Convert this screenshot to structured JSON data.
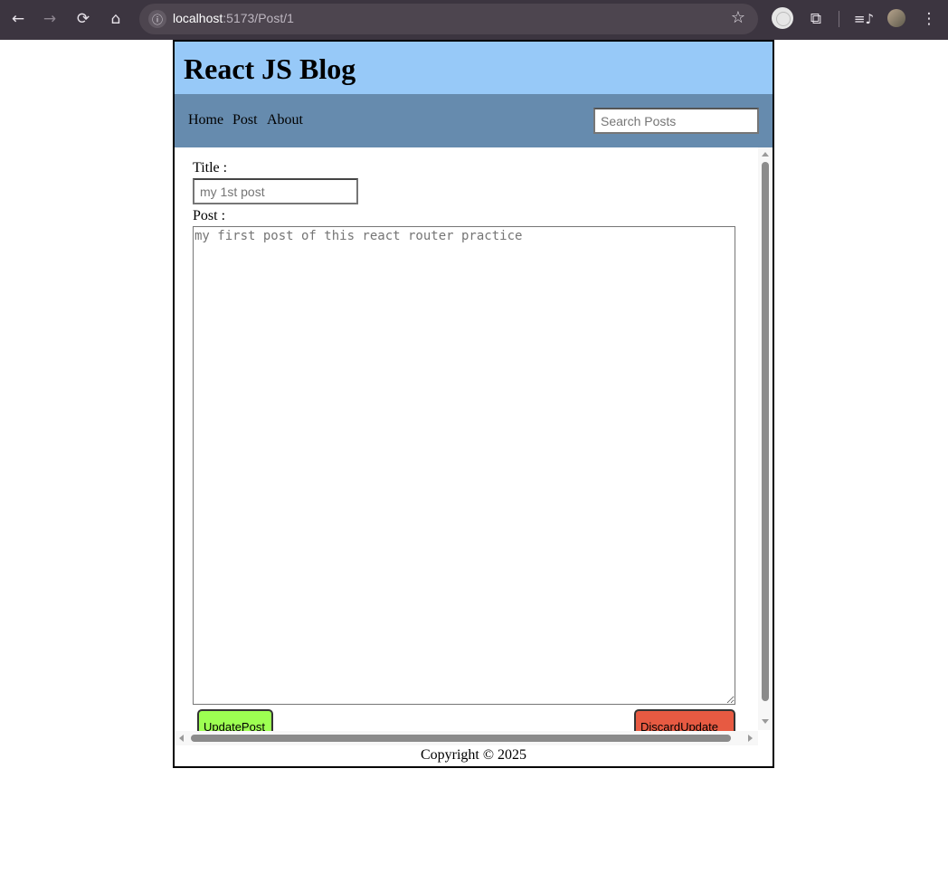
{
  "browser": {
    "url_host": "localhost",
    "url_rest": ":5173/Post/1",
    "back_icon": "←",
    "forward_icon": "→",
    "reload_icon": "⟳",
    "home_icon": "⌂",
    "info_icon": "ⓘ",
    "star_icon": "☆",
    "extensions_icon": "⧉",
    "media_icon": "≡♪",
    "menu_icon": "⋮"
  },
  "header": {
    "title": "React JS Blog"
  },
  "nav": {
    "items": [
      {
        "label": "Home"
      },
      {
        "label": "Post"
      },
      {
        "label": "About"
      }
    ],
    "search_placeholder": "Search Posts"
  },
  "form": {
    "title_label": "Title :",
    "title_placeholder": "my 1st post",
    "post_label": "Post :",
    "post_placeholder": "my first post of this react router practice",
    "update_button": "UpdatePost",
    "discard_button": "DiscardUpdate"
  },
  "colors": {
    "header_bg": "#97c9f8",
    "nav_bg": "#668bae",
    "update_bg": "#9dff52",
    "discard_bg": "#e75a42"
  },
  "footer": {
    "text": "Copyright © 2025"
  }
}
